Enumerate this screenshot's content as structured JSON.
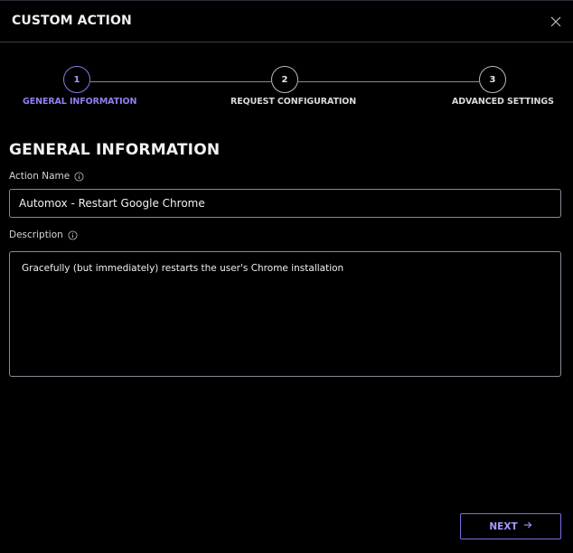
{
  "modal": {
    "title": "CUSTOM ACTION",
    "close_icon": "close-icon"
  },
  "stepper": {
    "steps": [
      {
        "number": "1",
        "label": "GENERAL INFORMATION",
        "active": true
      },
      {
        "number": "2",
        "label": "REQUEST CONFIGURATION",
        "active": false
      },
      {
        "number": "3",
        "label": "ADVANCED SETTINGS",
        "active": false
      }
    ]
  },
  "section": {
    "title": "GENERAL INFORMATION"
  },
  "fields": {
    "action_name": {
      "label": "Action Name",
      "value": "Automox - Restart Google Chrome",
      "info_icon": "info-icon"
    },
    "description": {
      "label": "Description",
      "value": "Gracefully (but immediately) restarts the user's Chrome installation",
      "info_icon": "info-icon"
    }
  },
  "footer": {
    "next_label": "NEXT",
    "next_icon": "arrow-right-icon"
  },
  "colors": {
    "accent": "#8f80f0",
    "background": "#000000",
    "border": "#8a8a96"
  }
}
